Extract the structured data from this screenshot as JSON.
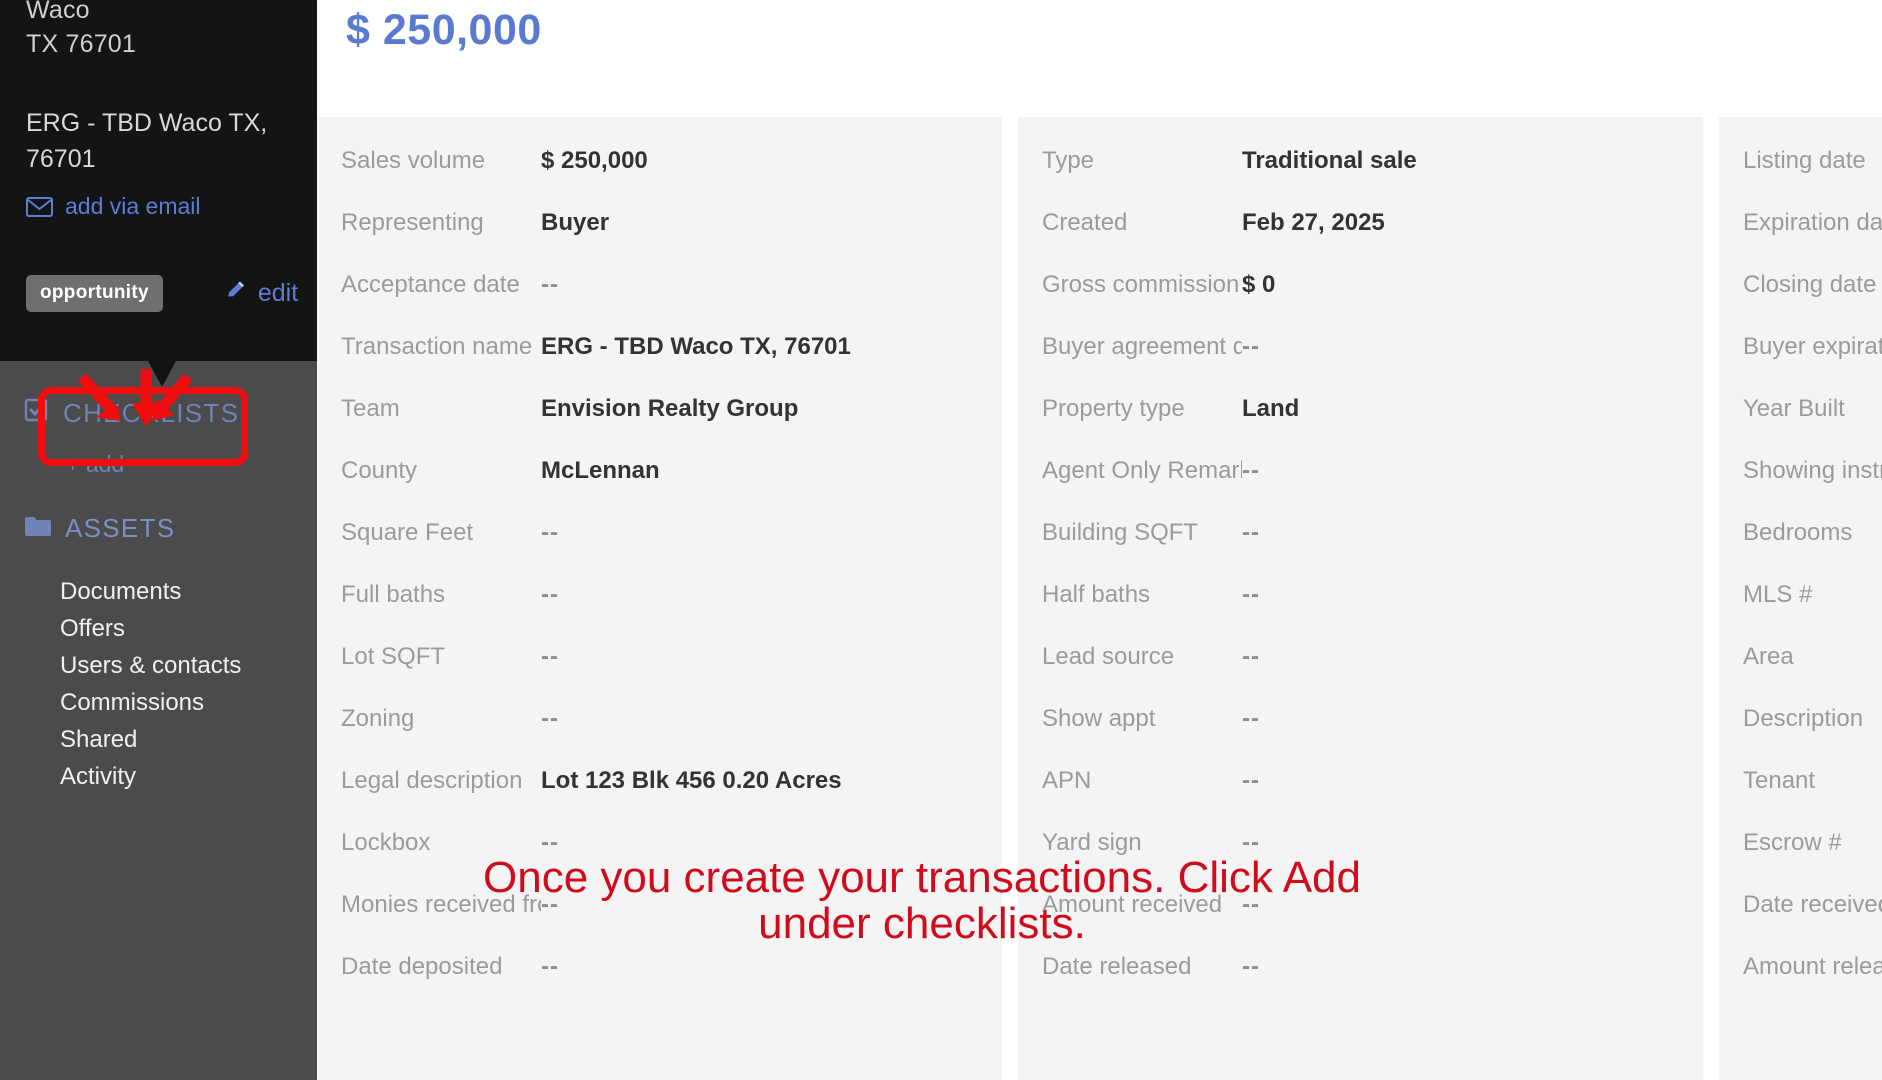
{
  "sidebar": {
    "address_city": "Waco",
    "address_state_zip": "TX 76701",
    "transaction_title": "ERG - TBD Waco TX, 76701",
    "add_via_email_label": "add via email",
    "tag_label": "opportunity",
    "edit_label": "edit",
    "checklists_heading": "CHECKLISTS",
    "checklists_add_label": "+ add",
    "assets_heading": "ASSETS",
    "nav_items": [
      {
        "label": "Documents"
      },
      {
        "label": "Offers"
      },
      {
        "label": "Users & contacts"
      },
      {
        "label": "Commissions"
      },
      {
        "label": "Shared"
      },
      {
        "label": "Activity"
      }
    ]
  },
  "main": {
    "price": "$ 250,000",
    "columns": [
      {
        "rows": [
          {
            "key": "Sales volume",
            "value": "$ 250,000"
          },
          {
            "key": "Representing",
            "value": "Buyer"
          },
          {
            "key": "Acceptance date",
            "value": "--"
          },
          {
            "key": "Transaction name",
            "value": "ERG - TBD Waco TX, 76701"
          },
          {
            "key": "Team",
            "value": "Envision Realty Group"
          },
          {
            "key": "County",
            "value": "McLennan"
          },
          {
            "key": "Square Feet",
            "value": "--"
          },
          {
            "key": "Full baths",
            "value": "--"
          },
          {
            "key": "Lot SQFT",
            "value": "--"
          },
          {
            "key": "Zoning",
            "value": "--"
          },
          {
            "key": "Legal description",
            "value": "Lot 123 Blk 456 0.20 Acres"
          },
          {
            "key": "Lockbox",
            "value": "--"
          },
          {
            "key": "Monies received from",
            "value": "--"
          },
          {
            "key": "Date deposited",
            "value": "--"
          }
        ]
      },
      {
        "rows": [
          {
            "key": "Type",
            "value": "Traditional sale"
          },
          {
            "key": "Created",
            "value": "Feb 27, 2025"
          },
          {
            "key": "Gross commission",
            "value": "$ 0"
          },
          {
            "key": "Buyer agreement da...",
            "value": "--"
          },
          {
            "key": "Property type",
            "value": "Land"
          },
          {
            "key": "Agent Only Remarks",
            "value": "--"
          },
          {
            "key": "Building SQFT",
            "value": "--"
          },
          {
            "key": "Half baths",
            "value": "--"
          },
          {
            "key": "Lead source",
            "value": "--"
          },
          {
            "key": "Show appt",
            "value": "--"
          },
          {
            "key": "APN",
            "value": "--"
          },
          {
            "key": "Yard sign",
            "value": "--"
          },
          {
            "key": "Amount received",
            "value": "--"
          },
          {
            "key": "Date released",
            "value": "--"
          }
        ]
      },
      {
        "rows": [
          {
            "key": "Listing date",
            "value": ""
          },
          {
            "key": "Expiration date",
            "value": ""
          },
          {
            "key": "Closing date",
            "value": ""
          },
          {
            "key": "Buyer expiration",
            "value": ""
          },
          {
            "key": "Year Built",
            "value": ""
          },
          {
            "key": "Showing instructions",
            "value": ""
          },
          {
            "key": "Bedrooms",
            "value": ""
          },
          {
            "key": "MLS #",
            "value": ""
          },
          {
            "key": "Area",
            "value": ""
          },
          {
            "key": "Description",
            "value": ""
          },
          {
            "key": "Tenant",
            "value": ""
          },
          {
            "key": "Escrow #",
            "value": ""
          },
          {
            "key": "Date received",
            "value": ""
          },
          {
            "key": "Amount released",
            "value": ""
          }
        ]
      }
    ]
  },
  "annotation": {
    "caption_line1": "Once you create your transactions. Click Add",
    "caption_line2": "under checklists.",
    "color": "#d00b1c"
  },
  "colors": {
    "accent_blue": "#5a7ad2",
    "sidebar_dark": "#141414",
    "sidebar_gray": "#4b4b4b",
    "card_bg": "#f4f4f4",
    "annotation_red": "#f10d0d"
  }
}
